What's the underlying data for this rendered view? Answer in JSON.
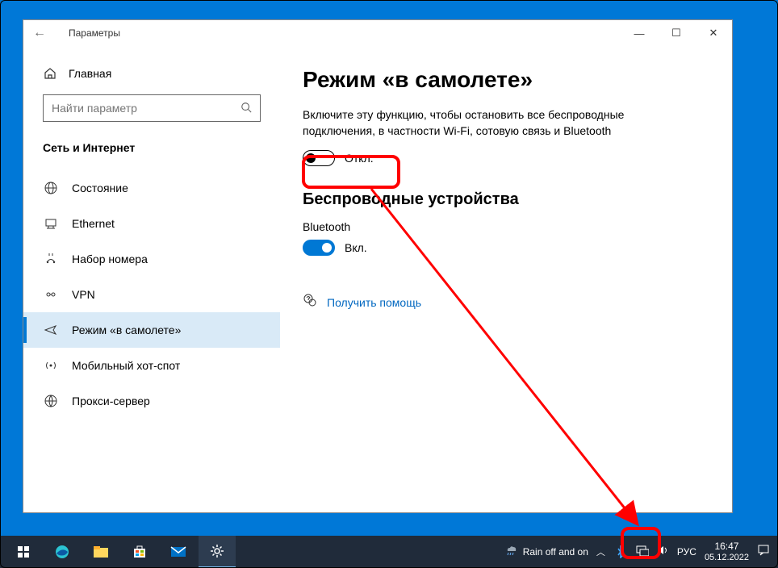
{
  "window": {
    "title": "Параметры",
    "minimize": "—",
    "maximize": "☐",
    "close": "✕"
  },
  "sidebar": {
    "home": "Главная",
    "search_placeholder": "Найти параметр",
    "category": "Сеть и Интернет",
    "items": [
      {
        "icon": "globe",
        "label": "Состояние"
      },
      {
        "icon": "ethernet",
        "label": "Ethernet"
      },
      {
        "icon": "dialup",
        "label": "Набор номера"
      },
      {
        "icon": "vpn",
        "label": "VPN"
      },
      {
        "icon": "airplane",
        "label": "Режим «в самолете»"
      },
      {
        "icon": "hotspot",
        "label": "Мобильный хот-спот"
      },
      {
        "icon": "proxy",
        "label": "Прокси-сервер"
      }
    ]
  },
  "main": {
    "heading": "Режим «в самолете»",
    "description": "Включите эту функцию, чтобы остановить все беспроводные подключения, в частности Wi-Fi, сотовую связь и Bluetooth",
    "airplane_state": "Откл.",
    "wireless_heading": "Беспроводные устройства",
    "bluetooth_label": "Bluetooth",
    "bluetooth_state": "Вкл.",
    "help": "Получить помощь"
  },
  "taskbar": {
    "weather": "Rain off and on",
    "lang": "РУС",
    "time": "16:47",
    "date": "05.12.2022"
  }
}
